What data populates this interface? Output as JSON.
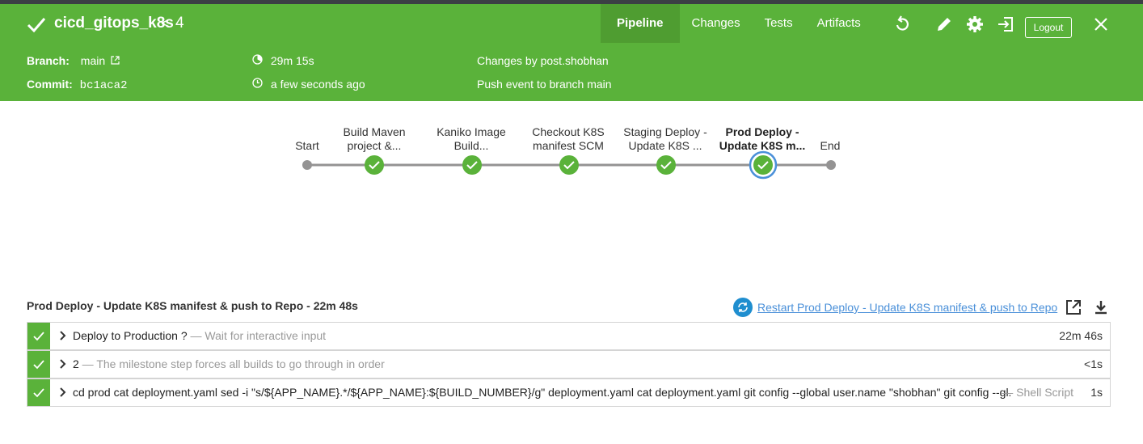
{
  "header": {
    "title": "cicd_gitops_k8s",
    "run_chevron": "<",
    "run_number": "4",
    "tabs": [
      {
        "label": "Pipeline",
        "active": true
      },
      {
        "label": "Changes",
        "active": false
      },
      {
        "label": "Tests",
        "active": false
      },
      {
        "label": "Artifacts",
        "active": false
      }
    ],
    "logout_label": "Logout",
    "branch_label": "Branch:",
    "branch_value": "main",
    "commit_label": "Commit:",
    "commit_value": "bc1aca2",
    "duration": "29m 15s",
    "time_ago": "a few seconds ago",
    "changes_by": "Changes by post.shobhan",
    "push_event": "Push event to branch main",
    "icons": [
      "replay-icon",
      "edit-icon",
      "gear-icon",
      "exit-icon",
      "close-icon"
    ]
  },
  "pipeline": {
    "stages": [
      {
        "line1": "Start",
        "line2": "",
        "status": "none"
      },
      {
        "line1": "Build Maven",
        "line2": "project &...",
        "status": "success"
      },
      {
        "line1": "Kaniko Image",
        "line2": "Build...",
        "status": "success"
      },
      {
        "line1": "Checkout K8S",
        "line2": "manifest SCM",
        "status": "success"
      },
      {
        "line1": "Staging Deploy -",
        "line2": "Update K8S ...",
        "status": "success"
      },
      {
        "line1": "Prod Deploy -",
        "line2": "Update K8S m...",
        "status": "success",
        "selected": true
      },
      {
        "line1": "End",
        "line2": "",
        "status": "none"
      }
    ]
  },
  "detail": {
    "section_title": "Prod Deploy - Update K8S manifest & push to Repo - 22m 48s",
    "restart_label": "Restart Prod Deploy - Update K8S manifest & push to Repo",
    "steps": [
      {
        "name": "Deploy to Production ?",
        "desc": " — Wait for interactive input",
        "type": "",
        "duration": "22m 46s"
      },
      {
        "name": "2",
        "desc": " — The milestone step forces all builds to go through in order",
        "type": "",
        "duration": "<1s"
      },
      {
        "name": "cd prod cat deployment.yaml sed -i \"s/${APP_NAME}.*/${APP_NAME}:${BUILD_NUMBER}/g\" deployment.yaml cat deployment.yaml git config --global user.name \"shobhan\" git config --gl...",
        "desc": "",
        "type": "— Shell Script",
        "duration": "1s"
      }
    ]
  },
  "colors": {
    "accent": "#5ab23a",
    "active_tab": "#4f9d31",
    "link": "#4a90d9",
    "selected_ring": "#4a90d9"
  }
}
